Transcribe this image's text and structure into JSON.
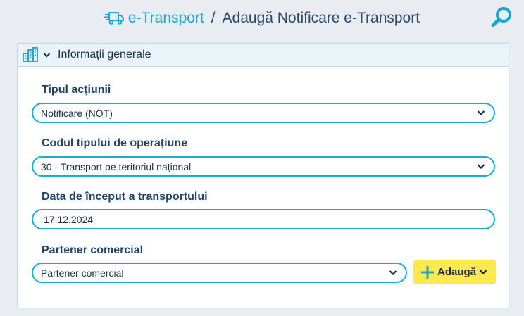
{
  "header": {
    "app_link": "e-Transport",
    "separator": "/",
    "page_title": "Adaugă Notificare e-Transport",
    "icons": {
      "app": "truck-icon",
      "search": "search-icon"
    }
  },
  "panel": {
    "title": "Informații generale",
    "icons": {
      "section": "building-icon",
      "toggle": "chevron-down-icon"
    }
  },
  "form": {
    "action_type": {
      "label": "Tipul acțiunii",
      "value": "Notificare (NOT)"
    },
    "operation_code": {
      "label": "Codul tipului de operațiune",
      "value": "30 - Transport pe teritoriul național"
    },
    "start_date": {
      "label": "Data de început a transportului",
      "value": "17.12.2024"
    },
    "partner": {
      "label": "Partener comercial",
      "placeholder": "Partener comercial"
    }
  },
  "add_button": {
    "label": "Adaugă",
    "icons": [
      "plus-icon",
      "chevron-down-icon"
    ]
  },
  "colors": {
    "accent": "#18aed4",
    "button": "#ffe94d",
    "heading": "#214569",
    "background": "#e9edf2"
  }
}
